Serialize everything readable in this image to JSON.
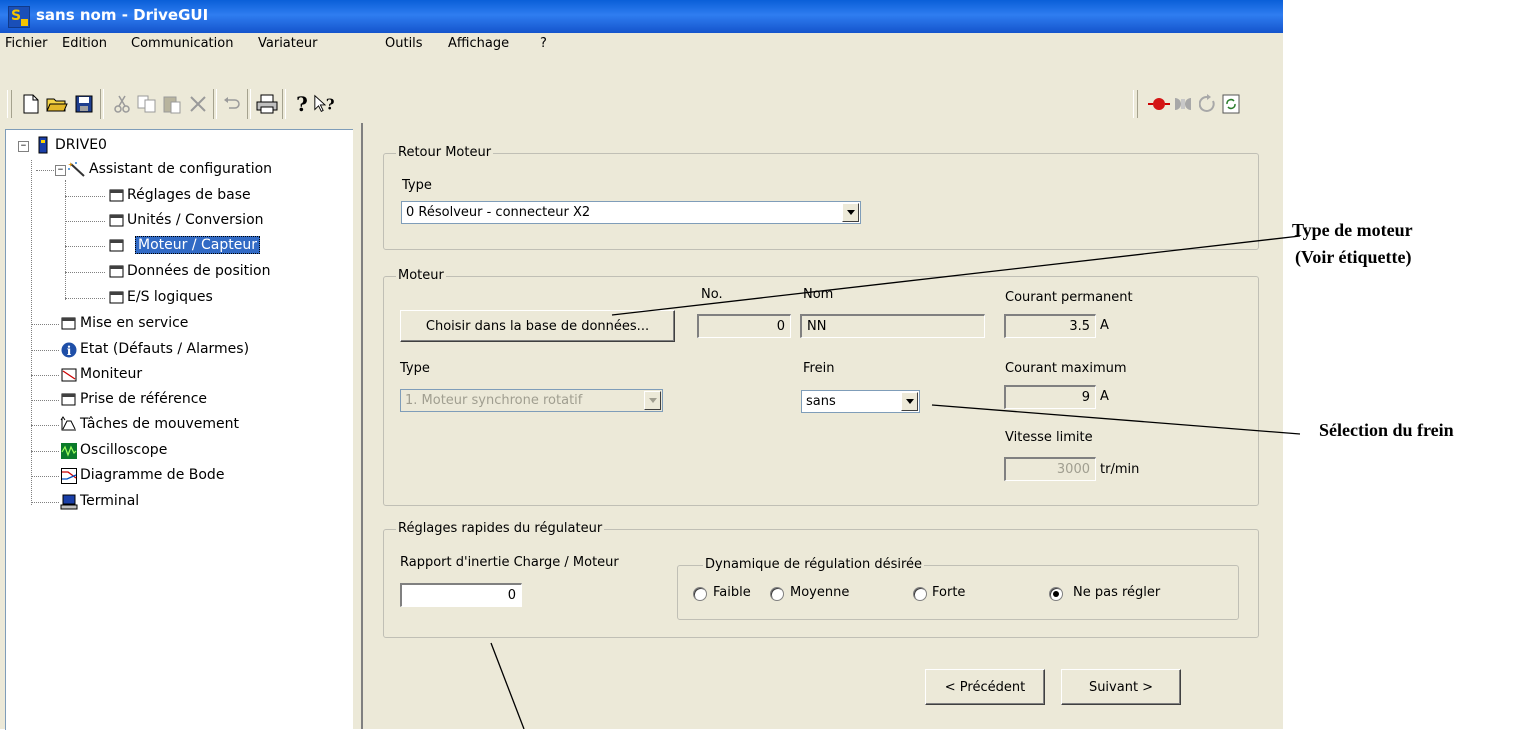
{
  "window": {
    "title": "sans nom - DriveGUI",
    "app_icon": "drivegui-app-icon"
  },
  "menu": [
    "Fichier",
    "Edition",
    "Communication",
    "Variateur",
    "Outils",
    "Affichage",
    "?"
  ],
  "toolbar": {
    "left_icons": [
      "new-file-icon",
      "open-folder-icon",
      "save-icon",
      "cut-icon",
      "copy-icon",
      "paste-icon",
      "delete-icon",
      "undo-icon",
      "print-icon",
      "help-icon",
      "context-help-icon"
    ],
    "right_icons": [
      "connect-icon",
      "disconnect-icon",
      "refresh-icon",
      "sync-icon"
    ]
  },
  "tree": {
    "root": "DRIVE0",
    "wizard": "Assistant de configuration",
    "wizard_items": [
      "Réglages de base",
      "Unités / Conversion",
      "Moteur / Capteur",
      "Données de position",
      "E/S logiques"
    ],
    "selected": "Moteur / Capteur",
    "items": [
      "Mise en service",
      "Etat (Défauts / Alarmes)",
      "Moniteur",
      "Prise de référence",
      "Tâches de mouvement",
      "Oscilloscope",
      "Diagramme de Bode",
      "Terminal"
    ]
  },
  "feedback": {
    "group_title": "Retour Moteur",
    "type_label": "Type",
    "type_value": "0 Résolveur - connecteur X2"
  },
  "motor": {
    "group_title": "Moteur",
    "choose_button": "Choisir dans la base de données...",
    "no_label": "No.",
    "no_value": "0",
    "name_label": "Nom",
    "name_value": "NN",
    "cont_current_label": "Courant permanent",
    "cont_current_value": "3.5",
    "cont_current_unit": "A",
    "type_label": "Type",
    "type_value": "1. Moteur synchrone rotatif",
    "brake_label": "Frein",
    "brake_value": "sans",
    "max_current_label": "Courant maximum",
    "max_current_value": "9",
    "max_current_unit": "A",
    "speed_label": "Vitesse limite",
    "speed_value": "3000",
    "speed_unit": "tr/min"
  },
  "tuning": {
    "group_title": "Réglages rapides du régulateur",
    "inertia_label": "Rapport d'inertie Charge / Moteur",
    "inertia_value": "0",
    "dynamics_title": "Dynamique de régulation désirée",
    "options": [
      "Faible",
      "Moyenne",
      "Forte",
      "Ne pas régler"
    ],
    "selected_option": "Ne pas régler"
  },
  "nav": {
    "prev": "< Précédent",
    "next": "Suivant >"
  },
  "annotations": {
    "motor_type_line1": "Type de moteur",
    "motor_type_line2": "(Voir étiquette)",
    "brake_selection": "Sélection du frein"
  }
}
